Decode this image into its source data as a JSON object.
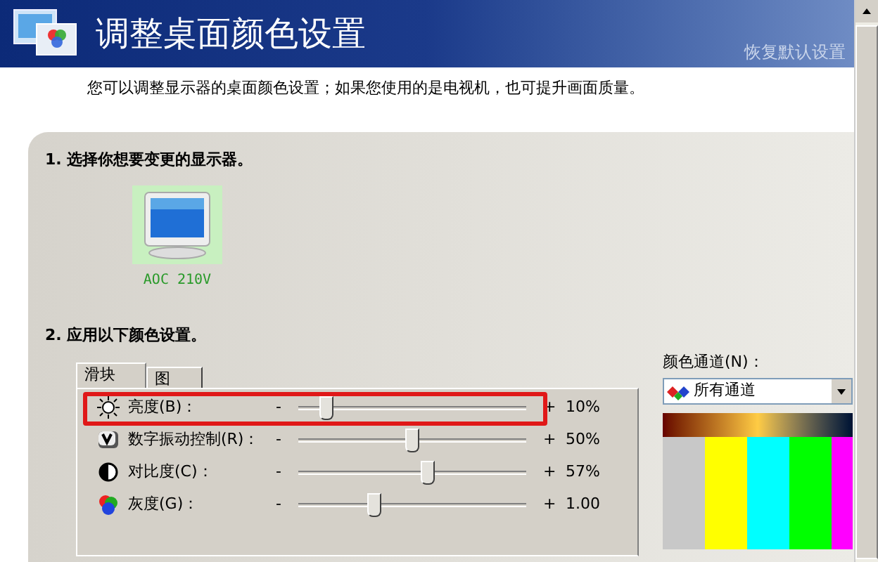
{
  "header": {
    "title": "调整桌面颜色设置",
    "restore_link": "恢复默认设置"
  },
  "description": "您可以调整显示器的桌面颜色设置；如果您使用的是电视机，也可提升画面质量。",
  "step1": {
    "heading": "1. 选择你想要变更的显示器。",
    "monitors": [
      {
        "name": "AOC 210V",
        "selected": true
      }
    ]
  },
  "step2": {
    "heading": "2. 应用以下颜色设置。",
    "tabs": [
      {
        "label": "滑块",
        "selected": true
      },
      {
        "label": "图",
        "selected": false
      }
    ],
    "sliders": [
      {
        "kind": "brightness",
        "label": "亮度(B)：",
        "minus": "-",
        "plus": "+",
        "level": 0.1,
        "reading": "10%",
        "highlighted": true
      },
      {
        "kind": "vibrance",
        "label": "数字振动控制(R)：",
        "minus": "-",
        "plus": "+",
        "level": 0.5,
        "reading": "50%",
        "highlighted": false
      },
      {
        "kind": "contrast",
        "label": "对比度(C)：",
        "minus": "-",
        "plus": "+",
        "level": 0.57,
        "reading": "57%",
        "highlighted": false
      },
      {
        "kind": "gamma",
        "label": "灰度(G)：",
        "minus": "-",
        "plus": "+",
        "level": 0.32,
        "reading": "1.00",
        "highlighted": false
      }
    ]
  },
  "channel": {
    "label": "颜色通道(N)：",
    "value": "所有通道"
  }
}
